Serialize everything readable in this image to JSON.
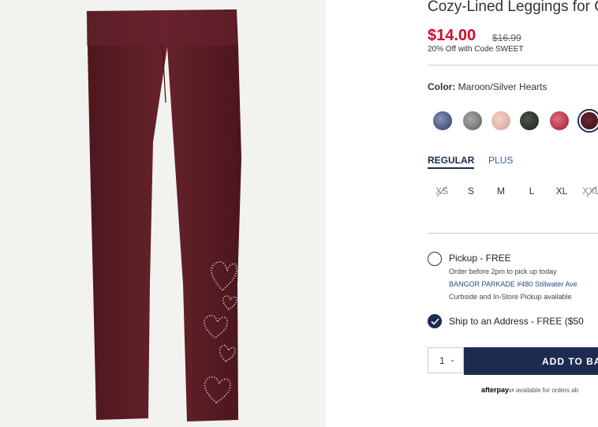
{
  "product": {
    "title": "Cozy-Lined Leggings for G",
    "price": "$14.00",
    "original_price": "$16.99",
    "promo": "20% Off with Code SWEET"
  },
  "color": {
    "label": "Color:",
    "value": "Maroon/Silver Hearts",
    "swatches": [
      {
        "name": "navy-floral",
        "hex": "#3d4a78"
      },
      {
        "name": "heather-grey",
        "hex": "#7a7a7a"
      },
      {
        "name": "light-pink",
        "hex": "#e2b3aa"
      },
      {
        "name": "dark-green",
        "hex": "#2a332a"
      },
      {
        "name": "red-sparkle",
        "hex": "#b5283c"
      },
      {
        "name": "maroon-silver-hearts",
        "hex": "#4a1a20"
      }
    ]
  },
  "size_tabs": [
    "REGULAR",
    "PLUS"
  ],
  "sizes": [
    "XS",
    "S",
    "M",
    "L",
    "XL",
    "XXL"
  ],
  "fulfillment": {
    "pickup_title": "Pickup - FREE",
    "pickup_sub": "Order before 2pm to pick up today",
    "pickup_store": "BANGOR PARKADE #480 Stillwater Ave",
    "pickup_note": "Curbside and In-Store Pickup available",
    "ship_title": "Ship to an Address - FREE ($50"
  },
  "cart": {
    "quantity": "1",
    "add_to_bag": "ADD TO BAG"
  },
  "afterpay": {
    "brand": "afterpay",
    "text": "available for orders ab"
  },
  "colors": {
    "price_red": "#cf0a2c",
    "navy": "#1e2b50",
    "leggings": "#5b1d24"
  }
}
